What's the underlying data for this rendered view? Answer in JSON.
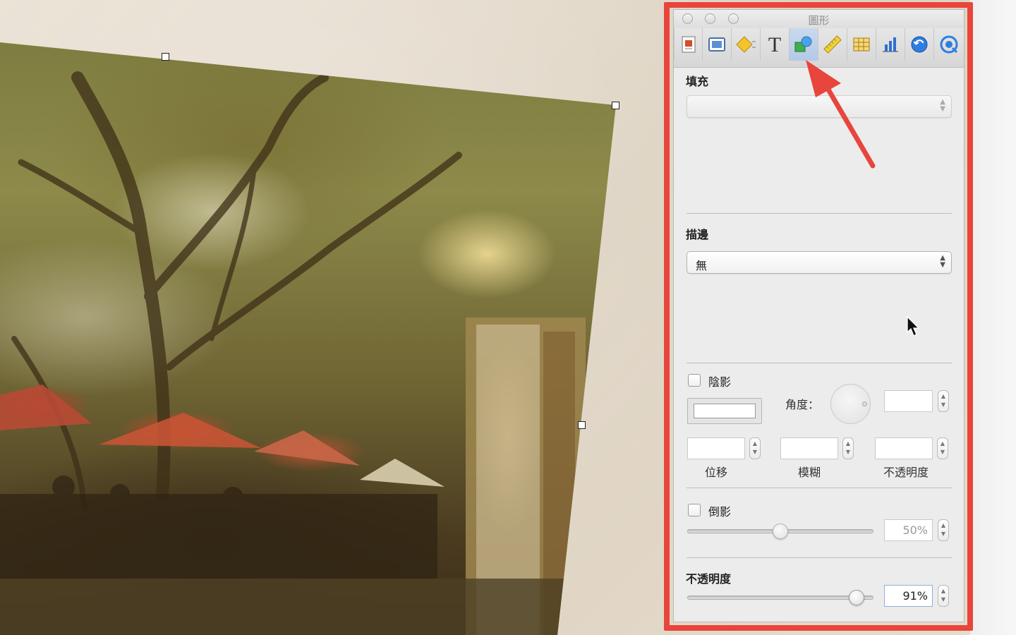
{
  "inspector": {
    "title": "圖形",
    "toolbar": [
      {
        "name": "document-inspector",
        "icon": "document-icon"
      },
      {
        "name": "layout-inspector",
        "icon": "layout-icon"
      },
      {
        "name": "wrap-inspector",
        "icon": "wrap-diamond-icon"
      },
      {
        "name": "text-inspector",
        "icon": "text-t-icon"
      },
      {
        "name": "graphic-inspector",
        "icon": "shapes-icon",
        "active": true
      },
      {
        "name": "metrics-inspector",
        "icon": "ruler-icon"
      },
      {
        "name": "table-inspector",
        "icon": "table-icon"
      },
      {
        "name": "chart-inspector",
        "icon": "bar-chart-icon"
      },
      {
        "name": "link-inspector",
        "icon": "link-arrow-icon"
      },
      {
        "name": "quicktime-inspector",
        "icon": "quicktime-icon"
      }
    ],
    "fill": {
      "label": "填充",
      "value": ""
    },
    "stroke": {
      "label": "描邊",
      "value": "無"
    },
    "shadow": {
      "label": "陰影",
      "checked": false,
      "angle_label": "角度：",
      "angle_value": "",
      "offset_label": "位移",
      "offset_value": "",
      "blur_label": "模糊",
      "blur_value": "",
      "opacity_label": "不透明度",
      "opacity_value": ""
    },
    "reflection": {
      "label": "倒影",
      "checked": false,
      "value": "50%",
      "level": 0.5
    },
    "opacity": {
      "label": "不透明度",
      "value": "91%",
      "level": 0.91
    }
  },
  "colors": {
    "highlight": "#e8453c",
    "active_tab": "#b4c9e6"
  }
}
